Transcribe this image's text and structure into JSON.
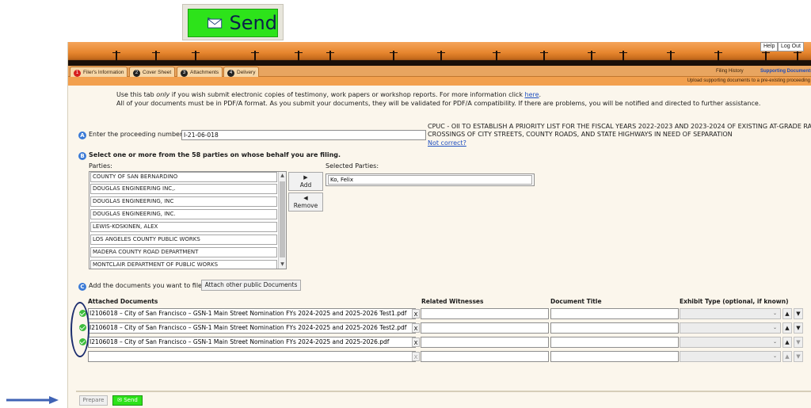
{
  "top_send": {
    "label": "Send"
  },
  "header": {
    "help": "Help",
    "logout": "Log Out"
  },
  "tabs": [
    {
      "num": "1",
      "label": "Filer's Information"
    },
    {
      "num": "2",
      "label": "Cover Sheet"
    },
    {
      "num": "3",
      "label": "Attachments"
    },
    {
      "num": "4",
      "label": "Delivery"
    }
  ],
  "right_tabs": {
    "history": "Filing History",
    "supporting": "Supporting Documents"
  },
  "subbar": "Upload supporting documents to a pre-existing proceeding",
  "intro": {
    "line1_a": "Use this tab",
    "line1_only": "only",
    "line1_b": "if you wish submit electronic copies of testimony, work papers or workshop reports. For more information click",
    "here": "here",
    "line2": "All of your documents must be in PDF/A format. As you submit your documents, they will be validated for PDF/A compatibility. If there are problems, you will be notified and directed to further assistance."
  },
  "step_a": {
    "badge": "A",
    "label": "Enter the proceeding number:",
    "value": "I-21-06-018",
    "description_1": "CPUC - OII TO ESTABLISH A PRIORITY LIST FOR THE FISCAL YEARS 2022-2023 AND 2023-2024 OF EXISTING AT-GRADE RAIL",
    "description_2": "CROSSINGS OF CITY STREETS, COUNTY ROADS, AND STATE HIGHWAYS IN NEED OF SEPARATION",
    "not_correct": "Not correct?"
  },
  "step_b": {
    "badge": "B",
    "label": "Select one or more from the 58 parties on whose behalf you are filing.",
    "parties_label": "Parties:",
    "selected_label": "Selected Parties:",
    "parties": [
      "COUNTY OF SAN BERNARDINO",
      "DOUGLAS ENGINEERING INC,.",
      "DOUGLAS ENGINEERING, INC",
      "DOUGLAS ENGINEERING, INC.",
      "LEWIS-KOSKINEN, ALEX",
      "LOS ANGELES COUNTY PUBLIC WORKS",
      "MADERA COUNTY ROAD DEPARTMENT",
      "MONTCLAIR DEPARTMENT OF PUBLIC WORKS"
    ],
    "selected": [
      "Ko, Felix"
    ],
    "add": "Add",
    "remove": "Remove"
  },
  "step_c": {
    "badge": "C",
    "label": "Add the documents you want to file.",
    "attach_button": "Attach other public Documents"
  },
  "columns": {
    "attached": "Attached Documents",
    "witnesses": "Related Witnesses",
    "title": "Document Title",
    "exhibit": "Exhibit Type (optional, if known)"
  },
  "documents": [
    {
      "name": "I2106018 – City of San Francisco – GSN-1 Main Street Nomination FYs 2024-2025 and 2025-2026 Test1.pdf",
      "ok": true
    },
    {
      "name": "I2106018 – City of San Francisco – GSN-1 Main Street Nomination FYs 2024-2025 and 2025-2026 Test2.pdf",
      "ok": true
    },
    {
      "name": "I2106018 – City of San Francisco – GSN-1 Main Street Nomination FYs 2024-2025 and 2025-2026.pdf",
      "ok": true
    },
    {
      "name": "",
      "ok": false
    }
  ],
  "remove_x": "X",
  "footer": {
    "prepare": "Prepare",
    "send": "Send"
  }
}
